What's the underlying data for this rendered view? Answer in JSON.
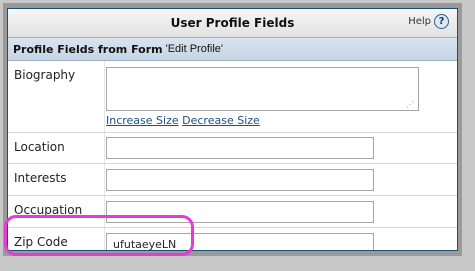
{
  "header": {
    "title": "User Profile Fields",
    "help_label": "Help",
    "help_icon": "?"
  },
  "section": {
    "label": "Profile Fields from Form",
    "form_name": "'Edit Profile'"
  },
  "fields": {
    "biography": {
      "label": "Biography",
      "value": ""
    },
    "increase_size": "Increase Size",
    "decrease_size": "Decrease Size",
    "location": {
      "label": "Location",
      "value": ""
    },
    "interests": {
      "label": "Interests",
      "value": ""
    },
    "occupation": {
      "label": "Occupation",
      "value": ""
    },
    "zip_code": {
      "label": "Zip Code",
      "value": "ufutaeyeLN"
    }
  },
  "colors": {
    "highlight": "#e43ad6",
    "link": "#1f4f86",
    "border": "#1d4e74"
  }
}
